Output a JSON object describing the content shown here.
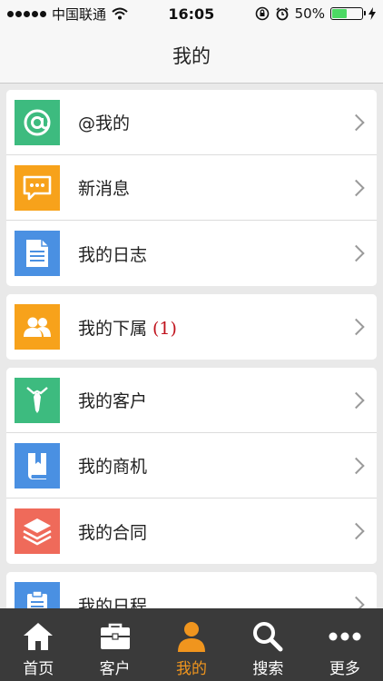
{
  "status_bar": {
    "carrier": "中国联通",
    "time": "16:05",
    "battery": "50%",
    "battery_level": 0.5
  },
  "nav": {
    "title": "我的"
  },
  "groups": [
    {
      "items": [
        {
          "label": "@我的",
          "icon": "at-icon",
          "color": "#3dbb7f"
        },
        {
          "label": "新消息",
          "icon": "chat-bubble-icon",
          "color": "#f7a21b"
        },
        {
          "label": "我的日志",
          "icon": "document-icon",
          "color": "#4a90e2"
        }
      ]
    },
    {
      "items": [
        {
          "label": "我的下属",
          "badge": "(1)",
          "icon": "people-icon",
          "color": "#f7a21b"
        }
      ]
    },
    {
      "items": [
        {
          "label": "我的客户",
          "icon": "tie-icon",
          "color": "#3dbb7f"
        },
        {
          "label": "我的商机",
          "icon": "book-icon",
          "color": "#4a90e2"
        },
        {
          "label": "我的合同",
          "icon": "layers-icon",
          "color": "#ef6a5a"
        }
      ]
    },
    {
      "items": [
        {
          "label": "我的日程",
          "icon": "clipboard-icon",
          "color": "#4a90e2"
        }
      ]
    }
  ],
  "tabs": [
    {
      "label": "首页",
      "icon": "home-icon",
      "active": false
    },
    {
      "label": "客户",
      "icon": "briefcase-icon",
      "active": false
    },
    {
      "label": "我的",
      "icon": "person-icon",
      "active": true
    },
    {
      "label": "搜索",
      "icon": "search-icon",
      "active": false
    },
    {
      "label": "更多",
      "icon": "more-icon",
      "active": false
    }
  ],
  "colors": {
    "accent": "#f0951e",
    "tab_bar": "#3a3a3a",
    "badge": "#c0121c"
  }
}
